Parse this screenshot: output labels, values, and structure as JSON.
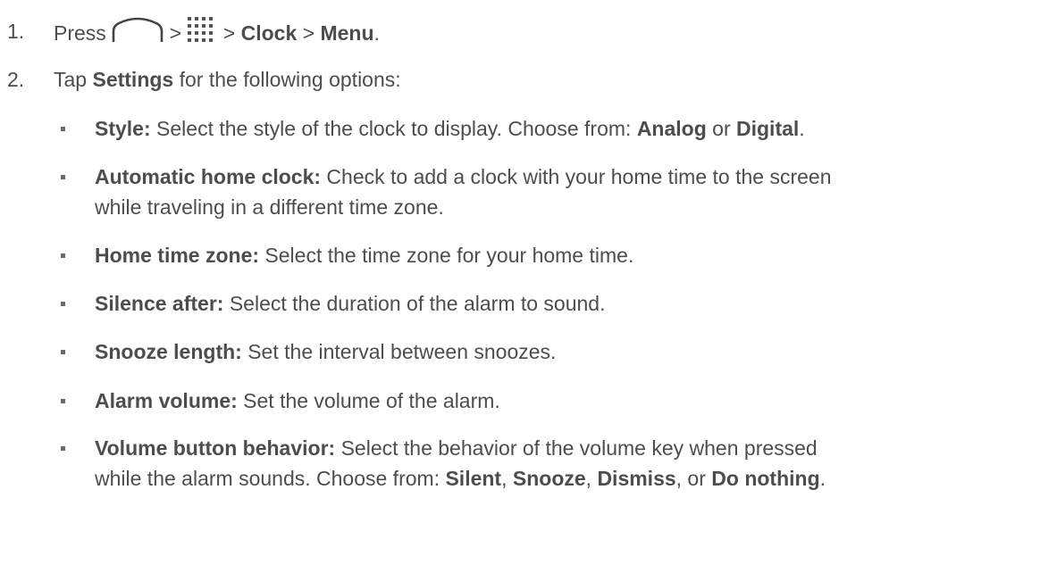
{
  "step1": {
    "number": "1.",
    "press": "Press",
    "sep1": ">",
    "sep2": ">",
    "clock": "Clock",
    "sep3": ">",
    "menu": "Menu",
    "end": ".",
    "icons": [
      "home-icon",
      "apps-grid-icon"
    ]
  },
  "step2": {
    "number": "2.",
    "tap": "Tap",
    "settings": "Settings",
    "rest": "for the following options:"
  },
  "options": [
    {
      "term": "Style:",
      "text": " Select the style of the clock to display. Choose from: ",
      "c1": "Analog",
      "mid": " or ",
      "c2": "Digital",
      "end": "."
    },
    {
      "term": "Automatic home clock:",
      "text": " Check to add a clock with your home time to the screen",
      "line2": "while traveling in a different time zone."
    },
    {
      "term": "Home time zone:",
      "text": " Select the time zone for your home time."
    },
    {
      "term": "Silence after:",
      "text": " Select the duration of the alarm to sound."
    },
    {
      "term": "Snooze length:",
      "text": " Set the interval between snoozes."
    },
    {
      "term": "Alarm volume:",
      "text": " Set the volume of the alarm."
    },
    {
      "term": "Volume button behavior:",
      "text": " Select the behavior of the volume key when pressed",
      "line2a": "while the alarm sounds. Choose from: ",
      "c1": "Silent",
      "s1": ", ",
      "c2": "Snooze",
      "s2": ", ",
      "c3": "Dismiss",
      "s3": ", or ",
      "c4": "Do nothing",
      "end": "."
    }
  ]
}
